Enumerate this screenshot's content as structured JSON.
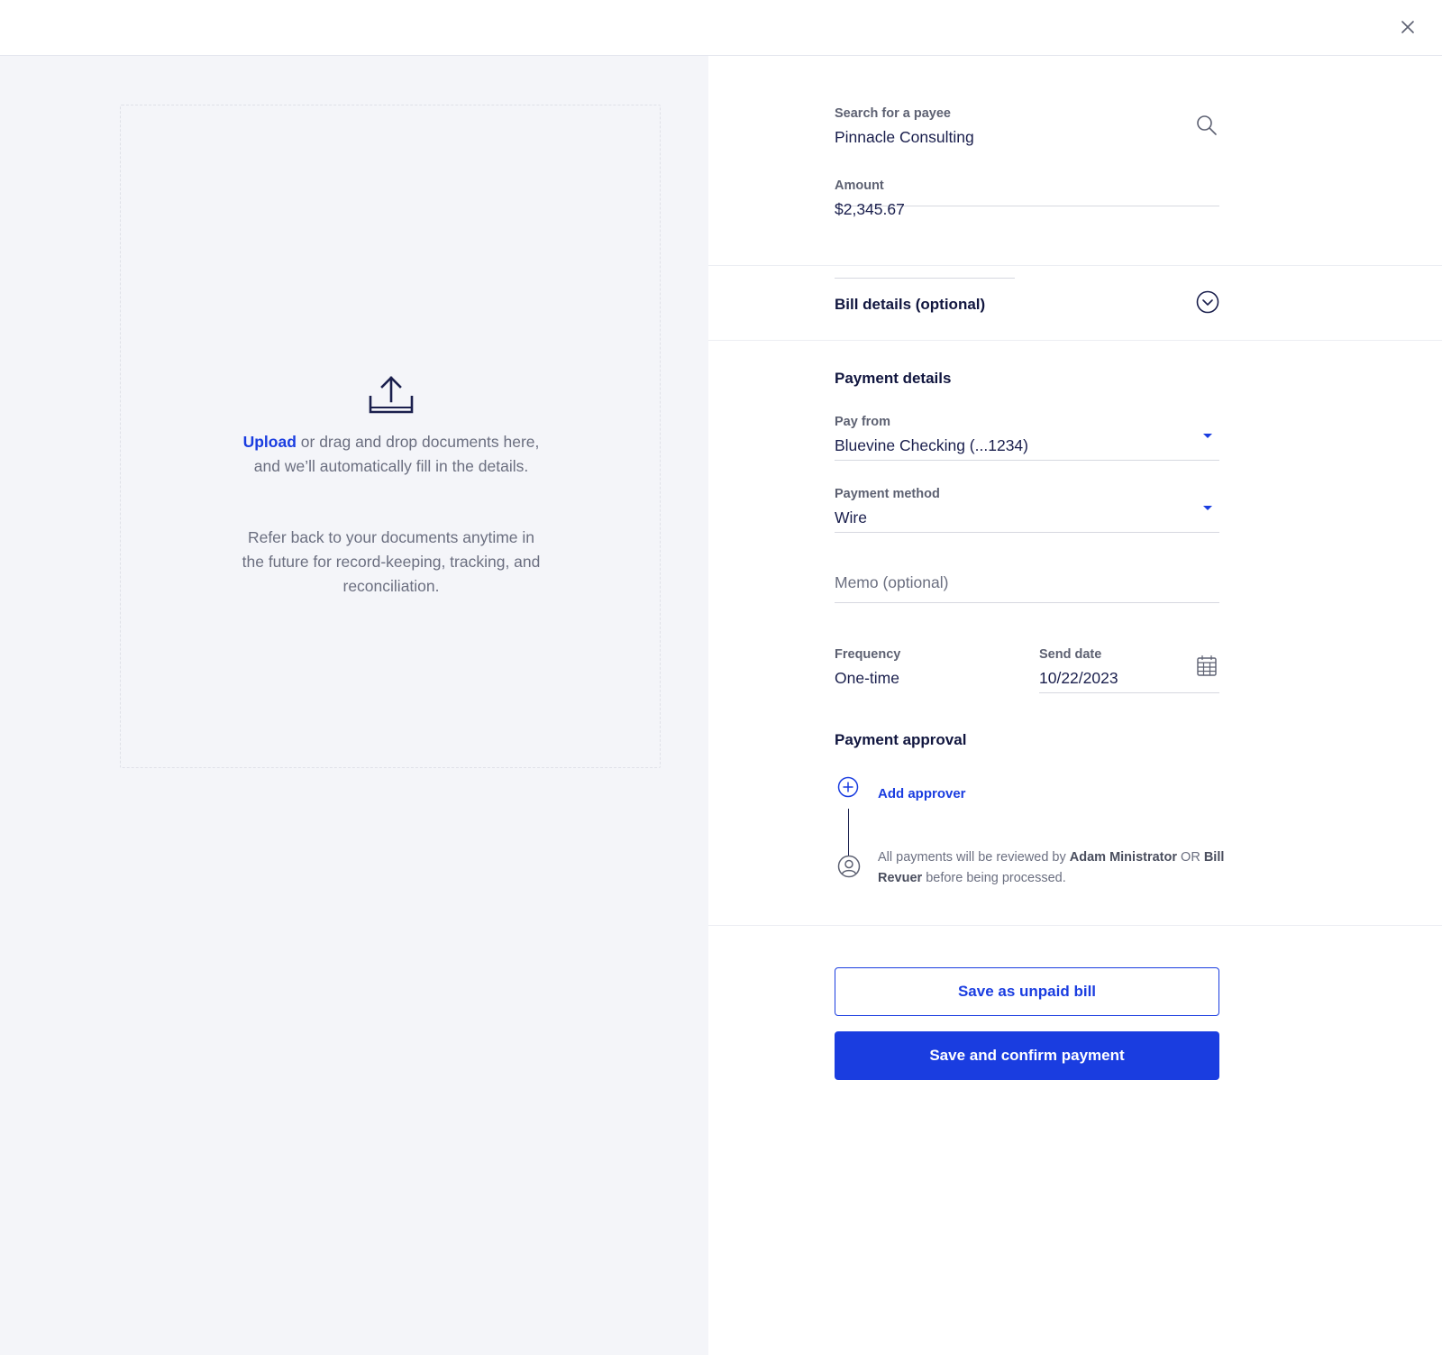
{
  "header": {
    "close_icon": "close-icon"
  },
  "upload": {
    "link_label": "Upload",
    "line1_rest": " or drag and drop documents here, and we’ll automatically fill in the details.",
    "line2": "Refer back to your documents anytime in the future for record-keeping, tracking, and reconciliation.",
    "icon": "upload-icon"
  },
  "payee": {
    "label": "Search for a payee",
    "value": "Pinnacle Consulting",
    "icon": "search-icon"
  },
  "amount": {
    "label": "Amount",
    "value": "$2,345.67"
  },
  "bill_details": {
    "title": "Bill details (optional)",
    "icon": "chevron-down-circle-icon"
  },
  "payment_details": {
    "title": "Payment details",
    "pay_from": {
      "label": "Pay from",
      "value": "Bluevine Checking (...1234)"
    },
    "payment_method": {
      "label": "Payment method",
      "value": "Wire"
    },
    "memo": {
      "placeholder": "Memo (optional)"
    },
    "frequency": {
      "label": "Frequency",
      "value": "One-time"
    },
    "send_date": {
      "label": "Send date",
      "value": "10/22/2023",
      "icon": "calendar-icon"
    }
  },
  "approval": {
    "title": "Payment approval",
    "add_label": "Add approver",
    "review_prefix": "All payments will be reviewed by ",
    "approver1": "Adam Ministrator",
    "or_text": " OR ",
    "approver2": "Bill Revuer",
    "review_suffix": " before being processed."
  },
  "actions": {
    "save_unpaid": "Save as unpaid bill",
    "save_confirm": "Save and confirm payment"
  },
  "colors": {
    "accent": "#1a3de0",
    "navy": "#1a1f4d",
    "panel_bg": "#f4f5f9"
  }
}
